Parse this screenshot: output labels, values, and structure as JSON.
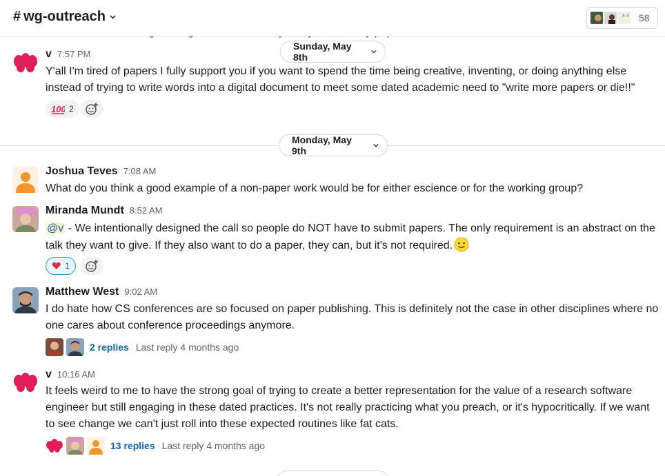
{
  "channel": {
    "name": "wg-outreach",
    "hash": "#",
    "member_count": "58"
  },
  "ghost_text": "research software engineering conferences, they really need many papers, , and",
  "dates": [
    {
      "label": "Sunday, May 8th"
    },
    {
      "label": "Monday, May 9th"
    }
  ],
  "messages": [
    {
      "author": "v",
      "time": "7:57 PM",
      "text": "Y'all I'm tired of papers I fully support you if you want to spend the time being creative, inventing, or doing anything else instead of trying to write words into a digital document to meet some dated academic need to \"write more papers or die!!\"",
      "reactions": [
        {
          "emoji": "100-emoji",
          "count": "2"
        }
      ]
    },
    {
      "author": "Joshua Teves",
      "time": "7:08 AM",
      "text": "What do you think a good example of a non-paper work would be for either escience or for the working group?"
    },
    {
      "author": "Miranda Mundt",
      "time": "8:52 AM",
      "mention": "@v",
      "text": " - We intentionally designed the call so people do NOT have to submit papers. The only requirement is an abstract on the talk they want to give. If they also want to do a paper, they can, but it's not required.",
      "reactions": [
        {
          "emoji": "heart-emoji",
          "count": "1"
        }
      ]
    },
    {
      "author": "Matthew West",
      "time": "9:02 AM",
      "text": "I do hate how CS conferences are so focused on paper publishing. This is definitely not the case in other disciplines where no one cares about conference proceedings anymore.",
      "thread": {
        "replies": "2 replies",
        "last_reply": "Last reply 4 months ago"
      }
    },
    {
      "author": "v",
      "time": "10:16 AM",
      "text": "It feels weird to me to have the strong goal of trying to create a better representation for the value of a research software engineer but still engaging in these dated practices. It's not really practicing what you preach, or it's hypocritically. If we want to see change we can't just roll into these expected routines like fat cats.",
      "thread": {
        "replies": "13 replies",
        "last_reply": "Last reply 4 months ago"
      }
    }
  ],
  "colors": {
    "link": "#1264a3",
    "mention_bg": "#fdf3cf",
    "v_avatar": "#e01e5a",
    "joshua_avatar": "#f2952c"
  }
}
